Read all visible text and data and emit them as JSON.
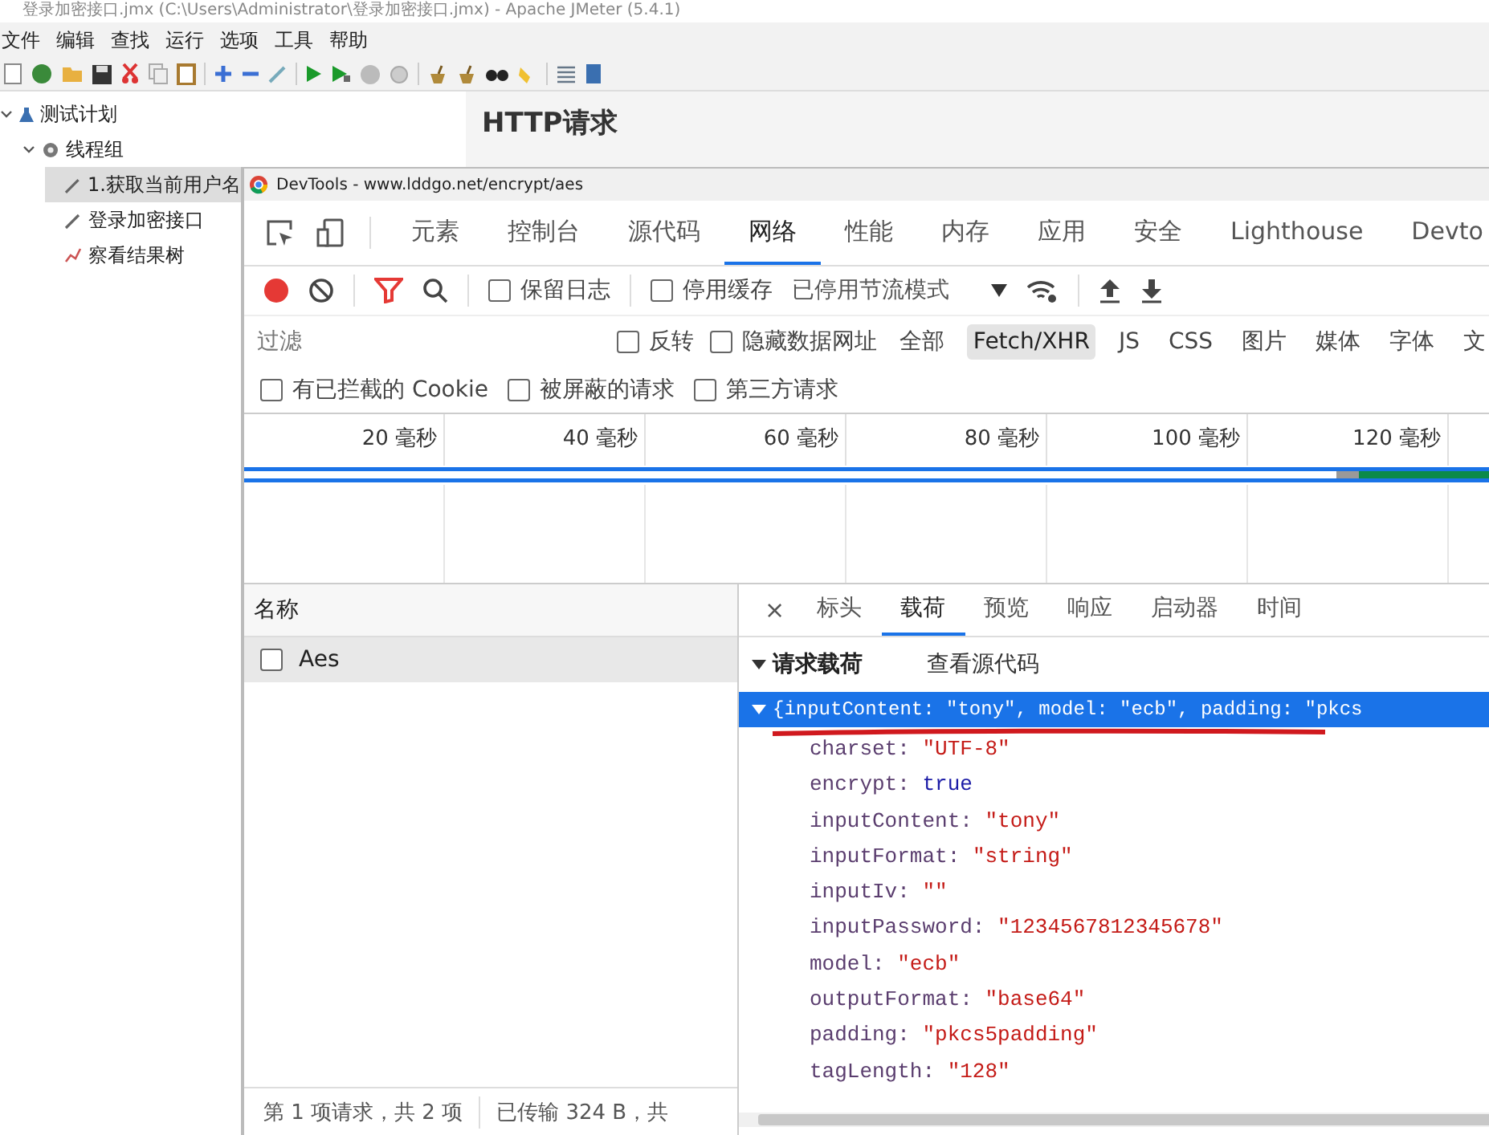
{
  "jmeter": {
    "title": "登录加密接口.jmx (C:\\Users\\Administrator\\登录加密接口.jmx) - Apache JMeter (5.4.1)",
    "menu": [
      "文件",
      "编辑",
      "查找",
      "运行",
      "选项",
      "工具",
      "帮助"
    ],
    "tree": [
      {
        "label": "测试计划",
        "kind": "plan",
        "expanded": true,
        "selected": false,
        "children": [
          {
            "label": "线程组",
            "kind": "group",
            "expanded": true,
            "selected": false,
            "children": [
              {
                "label": "1.获取当前用户名",
                "kind": "sampler",
                "selected": true
              },
              {
                "label": "登录加密接口",
                "kind": "sampler",
                "selected": false
              },
              {
                "label": "察看结果树",
                "kind": "listener",
                "selected": false
              }
            ]
          }
        ]
      }
    ],
    "panel_title": "HTTP请求"
  },
  "devtools": {
    "title": "DevTools - www.lddgo.net/encrypt/aes",
    "tabs": [
      {
        "label": "元素",
        "selected": false
      },
      {
        "label": "控制台",
        "selected": false
      },
      {
        "label": "源代码",
        "selected": false
      },
      {
        "label": "网络",
        "selected": true
      },
      {
        "label": "性能",
        "selected": false
      },
      {
        "label": "内存",
        "selected": false
      },
      {
        "label": "应用",
        "selected": false
      },
      {
        "label": "安全",
        "selected": false
      },
      {
        "label": "Lighthouse",
        "selected": false
      },
      {
        "label": "Devto",
        "selected": false
      }
    ],
    "toolbar": {
      "recording": true,
      "filter_active": true,
      "checkboxes": [
        {
          "label": "保留日志",
          "checked": false
        },
        {
          "label": "停用缓存",
          "checked": false
        }
      ],
      "throttle": "已停用节流模式"
    },
    "filter": {
      "placeholder": "过滤",
      "checkboxes": [
        {
          "label": "反转",
          "checked": false
        },
        {
          "label": "隐藏数据网址",
          "checked": false
        }
      ],
      "types": [
        {
          "label": "全部",
          "selected": false
        },
        {
          "label": "Fetch/XHR",
          "selected": true
        },
        {
          "label": "JS",
          "selected": false
        },
        {
          "label": "CSS",
          "selected": false
        },
        {
          "label": "图片",
          "selected": false
        },
        {
          "label": "媒体",
          "selected": false
        },
        {
          "label": "字体",
          "selected": false
        },
        {
          "label": "文",
          "selected": false
        }
      ]
    },
    "more_checkboxes": [
      {
        "label": "有已拦截的 Cookie",
        "checked": false
      },
      {
        "label": "被屏蔽的请求",
        "checked": false
      },
      {
        "label": "第三方请求",
        "checked": false
      }
    ],
    "timeline": {
      "ticks": [
        "20 毫秒",
        "40 毫秒",
        "60 毫秒",
        "80 毫秒",
        "100 毫秒",
        "120 毫秒"
      ]
    },
    "requests": {
      "header": "名称",
      "rows": [
        {
          "name": "Aes",
          "selected": true,
          "checked": false
        }
      ]
    },
    "status": [
      "第 1 项请求，共 2 项",
      "已传输 324 B，共"
    ],
    "detail": {
      "close": "×",
      "tabs": [
        {
          "label": "标头",
          "selected": false
        },
        {
          "label": "载荷",
          "selected": true
        },
        {
          "label": "预览",
          "selected": false
        },
        {
          "label": "响应",
          "selected": false
        },
        {
          "label": "启动器",
          "selected": false
        },
        {
          "label": "时间",
          "selected": false
        }
      ],
      "section": {
        "title": "请求载荷",
        "expanded": true,
        "link": "查看源代码"
      },
      "summary": {
        "text": "{inputContent: \"tony\", model: \"ecb\", padding: \"pkcs",
        "expanded": true,
        "selected": true
      },
      "properties": [
        {
          "key": "charset:",
          "value": "\"UTF-8\"",
          "kind": "string"
        },
        {
          "key": "encrypt:",
          "value": "true",
          "kind": "boolean"
        },
        {
          "key": "inputContent:",
          "value": "\"tony\"",
          "kind": "string"
        },
        {
          "key": "inputFormat:",
          "value": "\"string\"",
          "kind": "string"
        },
        {
          "key": "inputIv:",
          "value": "\"\"",
          "kind": "string"
        },
        {
          "key": "inputPassword:",
          "value": "\"1234567812345678\"",
          "kind": "string"
        },
        {
          "key": "model:",
          "value": "\"ecb\"",
          "kind": "string"
        },
        {
          "key": "outputFormat:",
          "value": "\"base64\"",
          "kind": "string"
        },
        {
          "key": "padding:",
          "value": "\"pkcs5padding\"",
          "kind": "string"
        },
        {
          "key": "tagLength:",
          "value": "\"128\"",
          "kind": "string"
        }
      ]
    }
  }
}
